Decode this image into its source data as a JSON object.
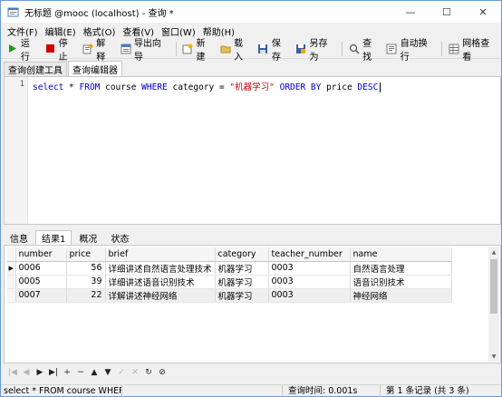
{
  "window": {
    "title": "无标题 @mooc (localhost) - 查询 *",
    "minimize": "—",
    "maximize": "☐",
    "close": "✕"
  },
  "menu": [
    {
      "label": "文件(F)"
    },
    {
      "label": "编辑(E)"
    },
    {
      "label": "格式(O)"
    },
    {
      "label": "查看(V)"
    },
    {
      "label": "窗口(W)"
    },
    {
      "label": "帮助(H)"
    }
  ],
  "toolbar": {
    "run": "运行",
    "stop": "停止",
    "explain": "解释",
    "export_wizard": "导出向导",
    "new": "新建",
    "load": "载入",
    "save": "保存",
    "save_as": "另存为",
    "find": "查找",
    "autowrap": "自动换行",
    "grid_view": "网格查看"
  },
  "query_tabs": [
    "查询创建工具",
    "查询编辑器"
  ],
  "editor": {
    "line_number": "1",
    "tokens": [
      "select",
      " * ",
      "FROM",
      " course ",
      "WHERE",
      " category = ",
      "\"机器学习\"",
      " ",
      "ORDER BY",
      " price ",
      "DESC"
    ]
  },
  "result_tabs": [
    "信息",
    "结果1",
    "概况",
    "状态"
  ],
  "grid": {
    "columns": [
      "number",
      "price",
      "brief",
      "category",
      "teacher_number",
      "name"
    ],
    "rows": [
      [
        "0006",
        "56",
        "详细讲述自然语言处理技术",
        "机器学习",
        "0003",
        "自然语言处理"
      ],
      [
        "0005",
        "39",
        "详细讲述语音识别技术",
        "机器学习",
        "0003",
        "语音识别技术"
      ],
      [
        "0007",
        "22",
        "详解讲述神经网络",
        "机器学习",
        "0003",
        "神经网络"
      ]
    ],
    "current_row_marker": "▶"
  },
  "navbar": [
    "|◀",
    "◀",
    "▶",
    "▶|",
    "+",
    "−",
    "▲",
    "▼",
    "✓",
    "✕",
    "↻",
    "⊘"
  ],
  "status": {
    "sql": "select * FROM course WHERE c",
    "query_time": "查询时间: 0.001s",
    "records": "第 1 条记录 (共 3 条)"
  },
  "colors": {
    "keyword": "#0000cc",
    "string": "#c00000",
    "run_icon": "#1a9a1a",
    "stop_icon": "#d00000"
  }
}
